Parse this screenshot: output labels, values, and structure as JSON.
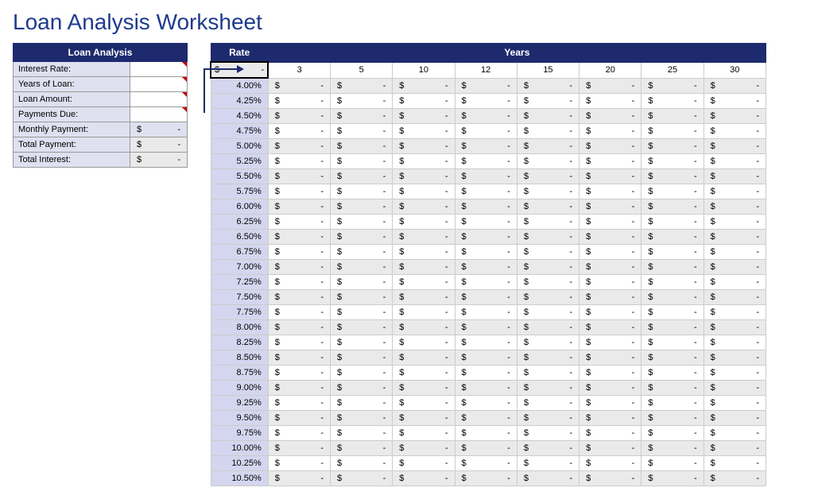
{
  "title": "Loan Analysis Worksheet",
  "panel": {
    "header": "Loan Analysis",
    "rows": [
      {
        "label": "Interest Rate:",
        "value": "",
        "style": "input",
        "red": true
      },
      {
        "label": "Years of Loan:",
        "value": "",
        "style": "input",
        "red": true
      },
      {
        "label": "Loan Amount:",
        "value": "",
        "style": "input",
        "red": true
      },
      {
        "label": "Payments Due:",
        "value": "",
        "style": "input",
        "red": true
      },
      {
        "label": "Monthly Payment:",
        "value": "-",
        "style": "money-highlight",
        "red": false
      },
      {
        "label": "Total Payment:",
        "value": "-",
        "style": "money-gray",
        "red": false
      },
      {
        "label": "Total Interest:",
        "value": "-",
        "style": "money-gray",
        "red": false
      }
    ]
  },
  "grid": {
    "rate_header": "Rate",
    "years_header": "Years",
    "first_cell_value": "-",
    "dollar_symbol": "$",
    "dash": "-",
    "years": [
      "3",
      "5",
      "10",
      "12",
      "15",
      "20",
      "25",
      "30"
    ],
    "rates": [
      "4.00%",
      "4.25%",
      "4.50%",
      "4.75%",
      "5.00%",
      "5.25%",
      "5.50%",
      "5.75%",
      "6.00%",
      "6.25%",
      "6.50%",
      "6.75%",
      "7.00%",
      "7.25%",
      "7.50%",
      "7.75%",
      "8.00%",
      "8.25%",
      "8.50%",
      "8.75%",
      "9.00%",
      "9.25%",
      "9.50%",
      "9.75%",
      "10.00%",
      "10.25%",
      "10.50%"
    ]
  }
}
